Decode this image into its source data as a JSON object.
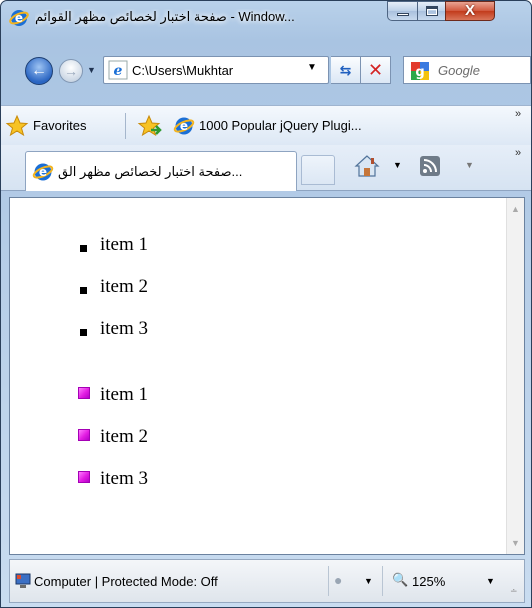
{
  "window": {
    "title": "صفحة اختبار لخصائص مظهر القوائم - Window..."
  },
  "caption": {
    "close_glyph": "X"
  },
  "nav": {
    "address": "C:\\Users\\Mukhtar",
    "search_placeholder": "Google"
  },
  "favorites": {
    "label": "Favorites",
    "link": "1000 Popular jQuery Plugi..."
  },
  "tab": {
    "title": "صفحة اختبار لخصائص مظهر الق..."
  },
  "content": {
    "list_square": [
      "item 1",
      "item 2",
      "item 3"
    ],
    "list_image": [
      "item 1",
      "item 2",
      "item 3"
    ]
  },
  "status": {
    "text": "Computer | Protected Mode: Off",
    "zoom": "125%"
  },
  "colors": {
    "accent": "#2a65c2",
    "bullet_image": "#e21ee2"
  },
  "icons": {
    "browser": "ie-icon",
    "back": "back-arrow-icon",
    "forward": "forward-arrow-icon",
    "refresh": "refresh-icon",
    "stop": "stop-icon",
    "search_provider": "google-icon",
    "favorites": "star-icon",
    "add_favorite": "add-favorite-icon",
    "home": "home-icon",
    "feeds": "rss-icon",
    "status_computer": "computer-icon",
    "zoom": "magnifier-icon"
  }
}
